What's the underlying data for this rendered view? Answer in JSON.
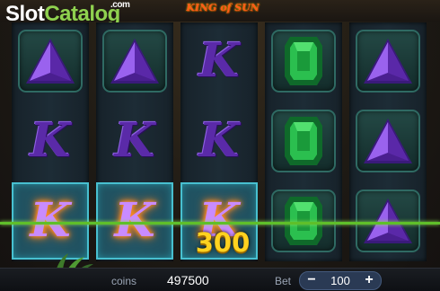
{
  "watermark": {
    "brand_a": "Slot",
    "brand_b": "Catalog",
    "suffix": ".com"
  },
  "game": {
    "title": "KING of SUN"
  },
  "reels": [
    [
      "purple-triangle",
      "purple-k",
      "purple-k"
    ],
    [
      "purple-triangle",
      "purple-k",
      "purple-k"
    ],
    [
      "purple-k",
      "purple-k",
      "purple-k"
    ],
    [
      "green-gem",
      "green-gem",
      "green-gem"
    ],
    [
      "purple-triangle",
      "purple-triangle",
      "purple-triangle"
    ]
  ],
  "winning_cells": [
    [
      0,
      2
    ],
    [
      1,
      2
    ],
    [
      2,
      2
    ]
  ],
  "win": {
    "amount": "300"
  },
  "footer": {
    "coins_label": "coins",
    "coins_value": "497500",
    "bet_label": "Bet",
    "bet_value": "100",
    "bet_minus": "−",
    "bet_plus": "+"
  },
  "colors": {
    "payline": "#5fbf2a",
    "win_amount": "#ffd21f",
    "win_cell": "#48c0d0"
  }
}
